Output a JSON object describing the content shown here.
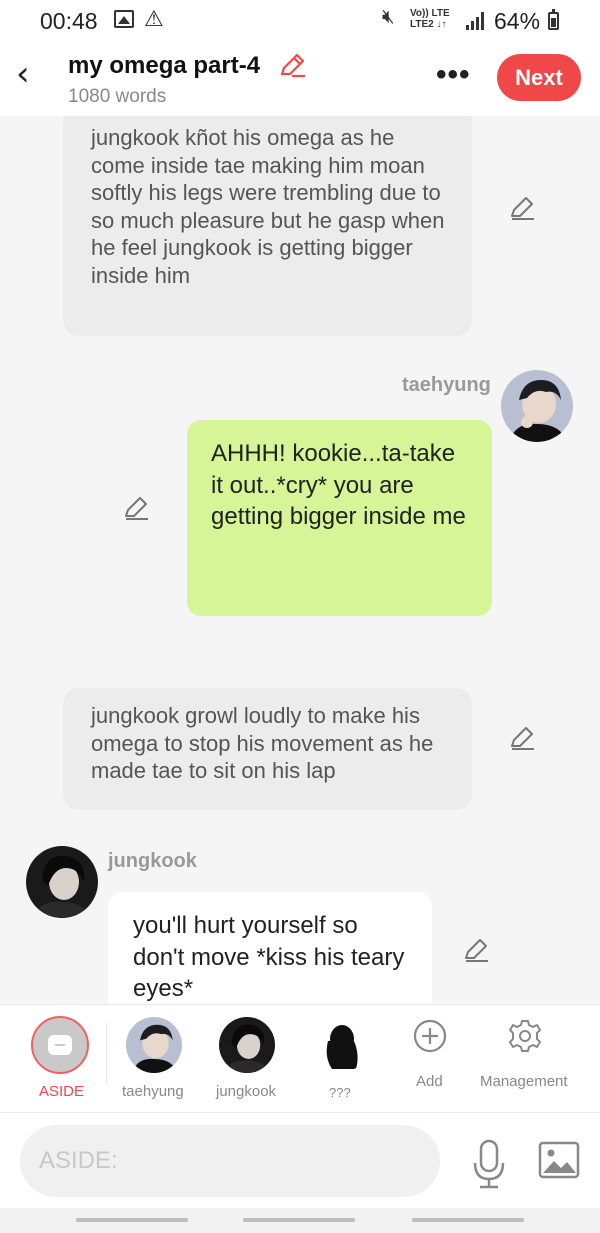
{
  "status_bar": {
    "time": "00:48",
    "network_top": "Vo)) LTE",
    "network_bottom": "LTE2 ↓↑",
    "battery": "64%"
  },
  "header": {
    "title": "my omega part-4",
    "word_count": "1080 words",
    "next_label": "Next",
    "accent_color": "#f04848"
  },
  "chat": {
    "messages": [
      {
        "type": "narration",
        "text": "jungkook kñot his omega as he come inside tae making him moan softly his legs were trembling due to so much pleasure but he gasp when he feel jungkook is getting bigger inside him"
      },
      {
        "type": "character",
        "speaker": "taehyung",
        "side": "right",
        "bubble_color": "#d5f596",
        "text": "AHHH! kookie...ta-take it out..*cry* you are getting bigger inside me"
      },
      {
        "type": "narration",
        "text": "jungkook growl loudly to make his omega to stop his movement as he made tae to sit on his lap"
      },
      {
        "type": "character",
        "speaker": "jungkook",
        "side": "left",
        "bubble_color": "#ffffff",
        "text": "you'll hurt yourself so don't move *kiss his teary eyes*"
      }
    ]
  },
  "toolbar": {
    "items": [
      {
        "label": "ASIDE",
        "icon": "aside-icon",
        "active": true
      },
      {
        "label": "taehyung",
        "icon": "taehyung-avatar"
      },
      {
        "label": "jungkook",
        "icon": "jungkook-avatar"
      },
      {
        "label": "???",
        "icon": "silhouette-avatar"
      },
      {
        "label": "Add",
        "icon": "plus-circle-icon"
      },
      {
        "label": "Management",
        "icon": "gear-icon"
      }
    ]
  },
  "input": {
    "placeholder": "ASIDE:"
  }
}
